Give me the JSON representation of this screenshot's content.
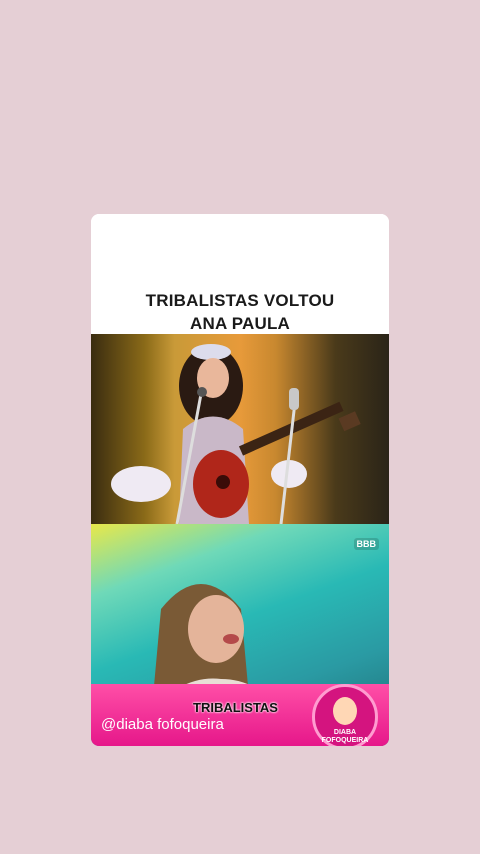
{
  "caption": {
    "line1": "TRIBALISTAS VOLTOU",
    "line2": "ANA PAULA"
  },
  "overlay": {
    "bbb_badge": "BBB",
    "band_label": "TRIBALISTAS",
    "handle": "@diaba fofoqueira"
  },
  "logo": {
    "line1": "DIABA",
    "line2": "FOFOQUEIRA"
  },
  "colors": {
    "page_background": "#e5cfd5",
    "pink_band": "#e6178a"
  }
}
